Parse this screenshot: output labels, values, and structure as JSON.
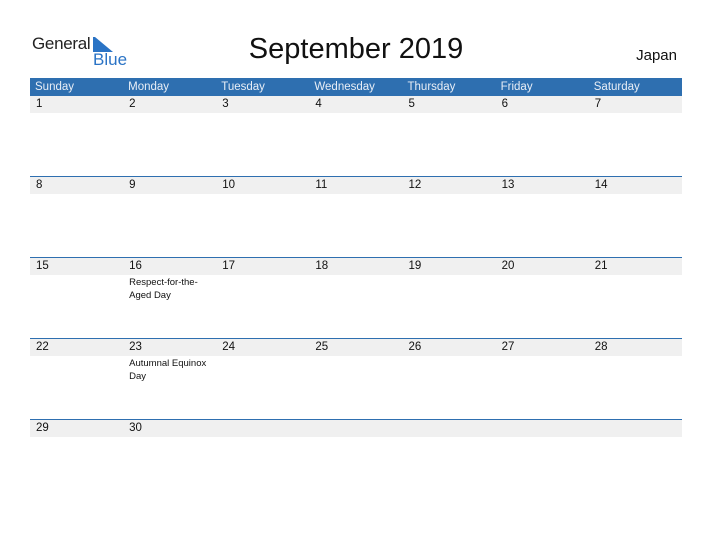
{
  "logo": {
    "part1": "General",
    "part2": "Blue",
    "accent_color": "#2a73c5"
  },
  "title": "September 2019",
  "country": "Japan",
  "colors": {
    "header_bg": "#2e6fb0",
    "day_row_bg": "#f0f0f0"
  },
  "weekdays": [
    "Sunday",
    "Monday",
    "Tuesday",
    "Wednesday",
    "Thursday",
    "Friday",
    "Saturday"
  ],
  "weeks": [
    {
      "days": [
        {
          "num": "1",
          "event": ""
        },
        {
          "num": "2",
          "event": ""
        },
        {
          "num": "3",
          "event": ""
        },
        {
          "num": "4",
          "event": ""
        },
        {
          "num": "5",
          "event": ""
        },
        {
          "num": "6",
          "event": ""
        },
        {
          "num": "7",
          "event": ""
        }
      ]
    },
    {
      "days": [
        {
          "num": "8",
          "event": ""
        },
        {
          "num": "9",
          "event": ""
        },
        {
          "num": "10",
          "event": ""
        },
        {
          "num": "11",
          "event": ""
        },
        {
          "num": "12",
          "event": ""
        },
        {
          "num": "13",
          "event": ""
        },
        {
          "num": "14",
          "event": ""
        }
      ]
    },
    {
      "days": [
        {
          "num": "15",
          "event": ""
        },
        {
          "num": "16",
          "event": "Respect-for-the-Aged Day"
        },
        {
          "num": "17",
          "event": ""
        },
        {
          "num": "18",
          "event": ""
        },
        {
          "num": "19",
          "event": ""
        },
        {
          "num": "20",
          "event": ""
        },
        {
          "num": "21",
          "event": ""
        }
      ]
    },
    {
      "days": [
        {
          "num": "22",
          "event": ""
        },
        {
          "num": "23",
          "event": "Autumnal Equinox Day"
        },
        {
          "num": "24",
          "event": ""
        },
        {
          "num": "25",
          "event": ""
        },
        {
          "num": "26",
          "event": ""
        },
        {
          "num": "27",
          "event": ""
        },
        {
          "num": "28",
          "event": ""
        }
      ]
    },
    {
      "days": [
        {
          "num": "29",
          "event": ""
        },
        {
          "num": "30",
          "event": ""
        },
        {
          "num": "",
          "event": ""
        },
        {
          "num": "",
          "event": ""
        },
        {
          "num": "",
          "event": ""
        },
        {
          "num": "",
          "event": ""
        },
        {
          "num": "",
          "event": ""
        }
      ]
    }
  ]
}
